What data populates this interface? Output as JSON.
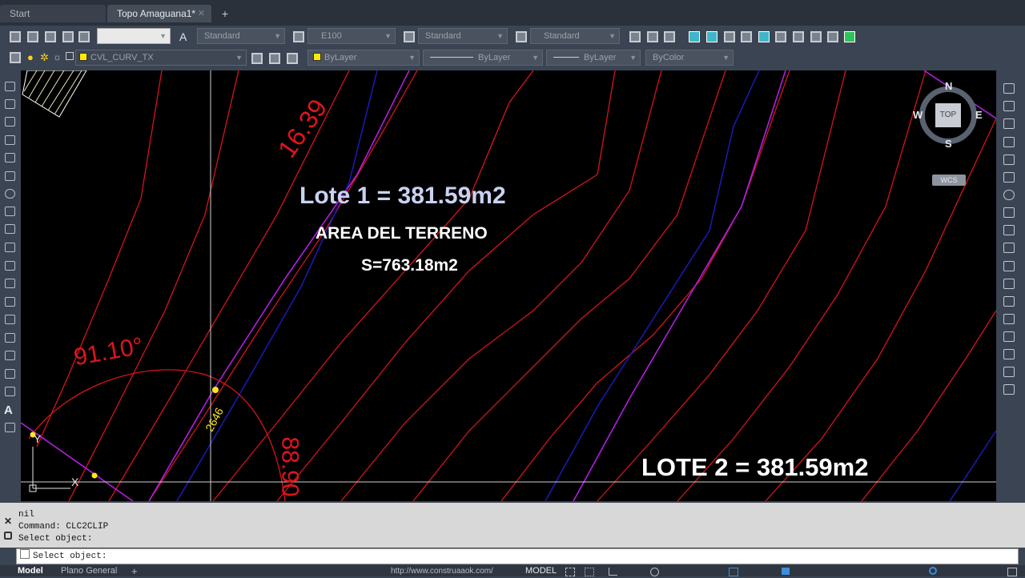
{
  "tabs": {
    "start": "Start",
    "active": "Topo Amaguana1*",
    "close": "✕",
    "plus": "+"
  },
  "toolbar1": {
    "text_style": "Standard",
    "dim_style": "E100",
    "table_style": "Standard",
    "mleader_style": "Standard"
  },
  "toolbar2": {
    "layer": "CVL_CURV_TX",
    "color": "ByLayer",
    "linetype": "ByLayer",
    "lineweight": "ByLayer",
    "plotstyle": "ByColor"
  },
  "viewcube": {
    "n": "N",
    "s": "S",
    "e": "E",
    "w": "W",
    "top": "TOP",
    "wcs": "WCS"
  },
  "drawing": {
    "lote1": "Lote 1 = 381.59m2",
    "area_title": "AREA DEL TERRENO",
    "area_value": "S=763.18m2",
    "lote2": "LOTE 2 = 381.59m2",
    "contour_label_top": "16.39",
    "angle_label": "91.10°",
    "dim_small": "2646",
    "contour_label_bottom": "88.90",
    "ucs_x": "X",
    "ucs_y": "Y"
  },
  "colors": {
    "contour": "#d6141c",
    "purple": "#b31ee0",
    "blue": "#1c1ab8",
    "label_red": "#e0141c",
    "lote1": "#c9d2f0",
    "white": "#ffffff"
  },
  "command": {
    "history": [
      "nil",
      "Command: CLC2CLIP",
      "Select object:"
    ],
    "prompt": "Select object:"
  },
  "status": {
    "model": "Model",
    "layout1": "Plano General",
    "add": "+",
    "url": "http://www.construaaok.com/",
    "mode": "MODEL"
  }
}
